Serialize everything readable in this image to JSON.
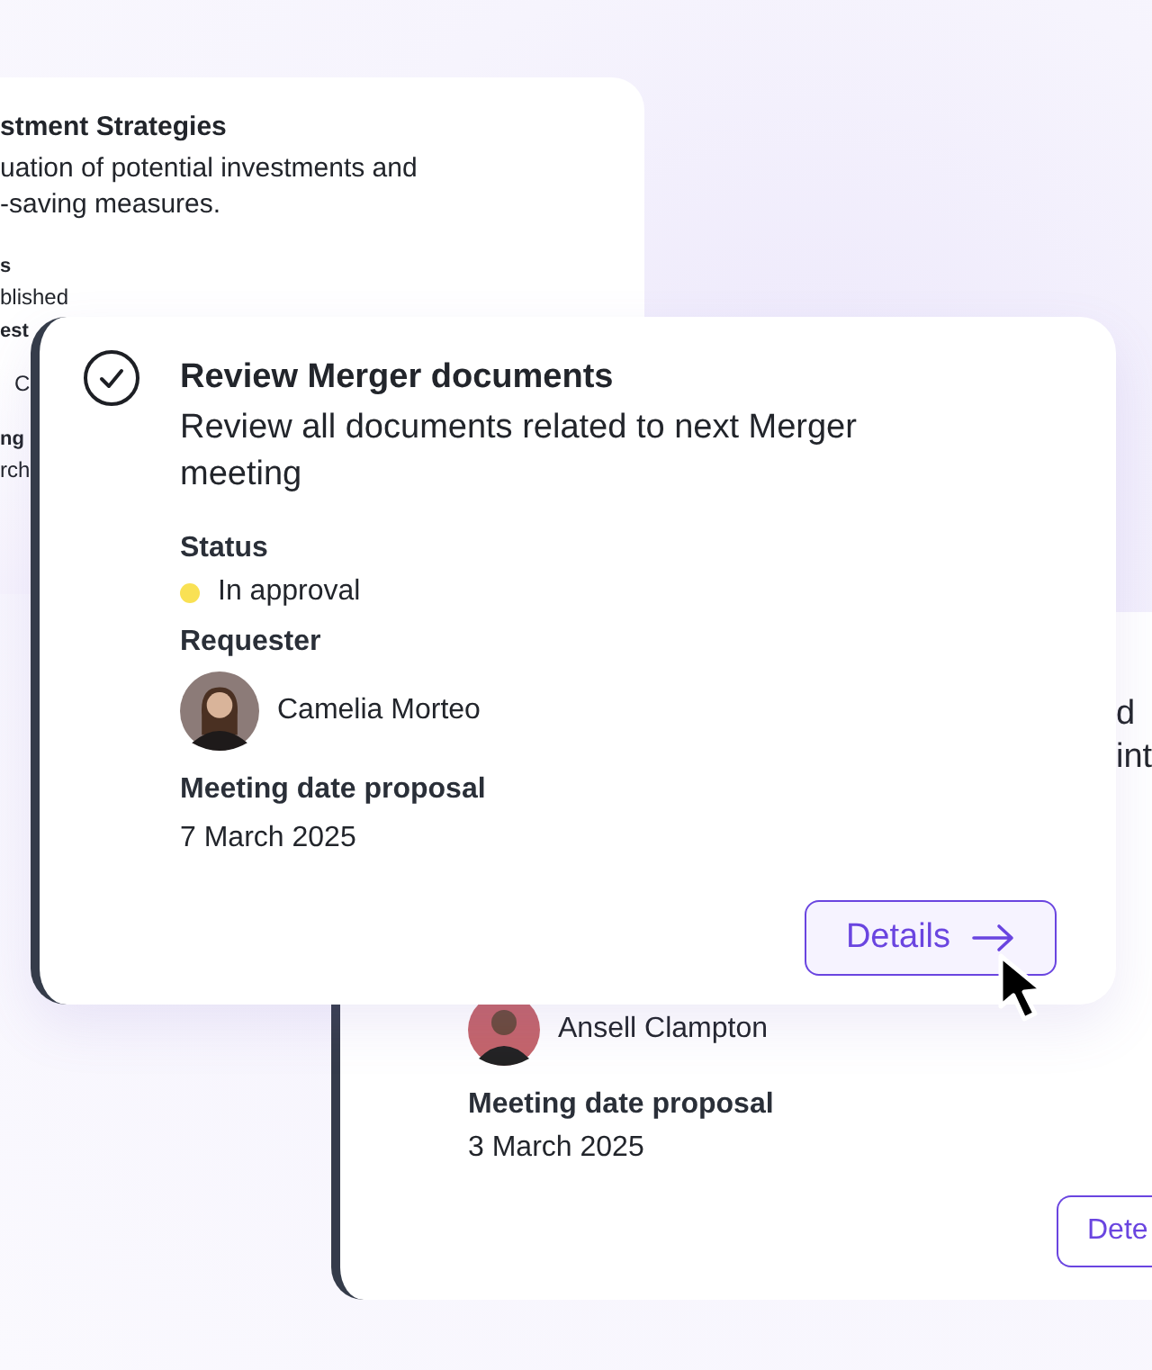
{
  "back_card_top": {
    "title": "stment Strategies",
    "description_lines": [
      "uation of potential investments and",
      "-saving measures."
    ],
    "fields": [
      {
        "label": "s",
        "value": "blished"
      },
      {
        "label": "est",
        "value": "C"
      },
      {
        "label": "ng",
        "value": "rch"
      }
    ]
  },
  "main_card": {
    "checked": true,
    "title": "Review Merger documents",
    "description": "Review all documents related to next Merger meeting",
    "status": {
      "label": "Status",
      "value": "In approval",
      "color": "#f9e154"
    },
    "requester": {
      "label": "Requester",
      "name": "Camelia Morteo"
    },
    "date": {
      "label": "Meeting date proposal",
      "value": "7 March 2025"
    },
    "button": "Details"
  },
  "back_card_bottom": {
    "description_lines": [
      "d",
      "int"
    ],
    "requester_name": "Ansell Clampton",
    "date": {
      "label": "Meeting date proposal",
      "value": "3 March 2025"
    },
    "button": "Dete"
  }
}
